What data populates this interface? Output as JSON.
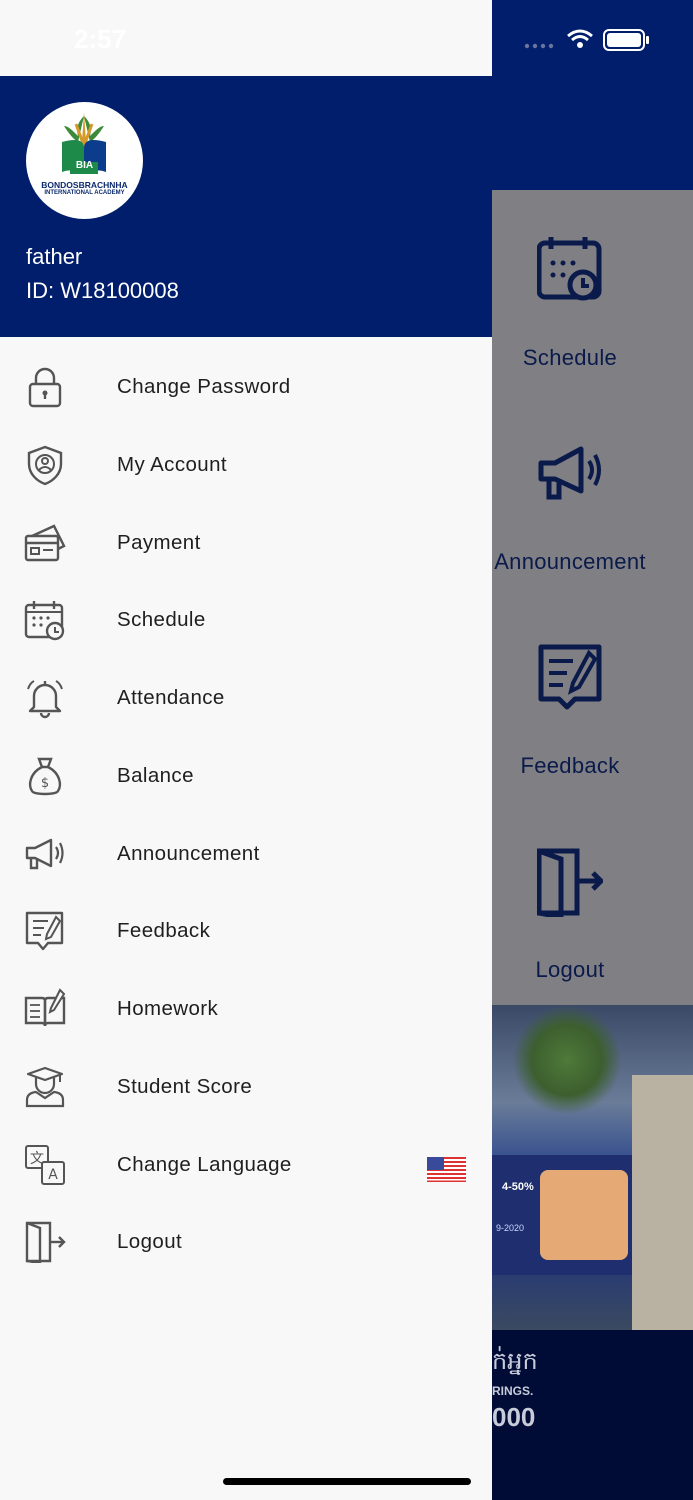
{
  "status_bar": {
    "time": "2:57"
  },
  "profile": {
    "logo_text_line1": "BONDOSBRACHNHA",
    "logo_text_line2": "INTERNATIONAL ACADEMY",
    "logo_badge": "BIA",
    "name": "father",
    "id_label": "ID: W18100008"
  },
  "menu": {
    "items": [
      {
        "label": "Change Password",
        "icon": "lock-icon"
      },
      {
        "label": "My Account",
        "icon": "shield-user-icon"
      },
      {
        "label": "Payment",
        "icon": "payment-card-icon"
      },
      {
        "label": "Schedule",
        "icon": "calendar-clock-icon"
      },
      {
        "label": "Attendance",
        "icon": "bell-icon"
      },
      {
        "label": "Balance",
        "icon": "money-bag-icon"
      },
      {
        "label": "Announcement",
        "icon": "megaphone-icon"
      },
      {
        "label": "Feedback",
        "icon": "feedback-note-icon"
      },
      {
        "label": "Homework",
        "icon": "book-pencil-icon"
      },
      {
        "label": "Student Score",
        "icon": "graduate-icon"
      },
      {
        "label": "Change Language",
        "icon": "translate-icon",
        "flag": "us-flag-icon"
      },
      {
        "label": "Logout",
        "icon": "logout-door-icon"
      }
    ]
  },
  "background": {
    "tiles": [
      {
        "label": "Schedule",
        "icon": "calendar-clock-icon"
      },
      {
        "label": "Announcement",
        "icon": "megaphone-icon"
      },
      {
        "label": "Feedback",
        "icon": "feedback-note-icon"
      },
      {
        "label": "Logout",
        "icon": "logout-door-icon"
      }
    ],
    "photo_text": "4-50%",
    "photo_year": "9-2020",
    "bottom_line1": "ក់អ្នក",
    "bottom_line2": "RINGS.",
    "bottom_line3": "000"
  },
  "colors": {
    "header": "#011e6c",
    "drawer_bg": "#f8f8f8",
    "overlay": "#7f7f84",
    "icon_stroke": "#555555",
    "tile_icon": "#0a1a4a"
  }
}
